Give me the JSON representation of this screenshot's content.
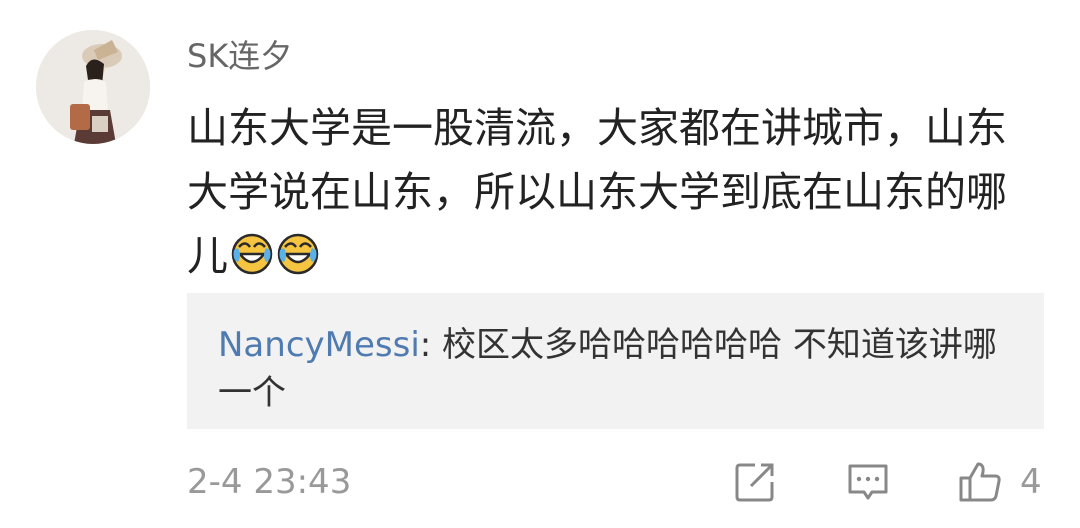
{
  "comment": {
    "username": "SK连夕",
    "text": "山东大学是一股清流，大家都在讲城市，山东大学说在山东，所以山东大学到底在山东的哪儿",
    "emojis": [
      "laughing-crying-icon",
      "laughing-crying-icon"
    ]
  },
  "reply": {
    "username": "NancyMessi",
    "separator": ": ",
    "text": "校区太多哈哈哈哈哈哈 不知道该讲哪一个"
  },
  "footer": {
    "timestamp": "2-4 23:43",
    "like_count": "4",
    "icons": [
      "share-icon",
      "reply-icon",
      "like-icon"
    ]
  },
  "colors": {
    "username": "#666666",
    "text": "#222222",
    "reply_username": "#4f7bb0",
    "reply_background": "#f2f2f2",
    "meta": "#999999",
    "emoji_face": "#f5c542"
  }
}
